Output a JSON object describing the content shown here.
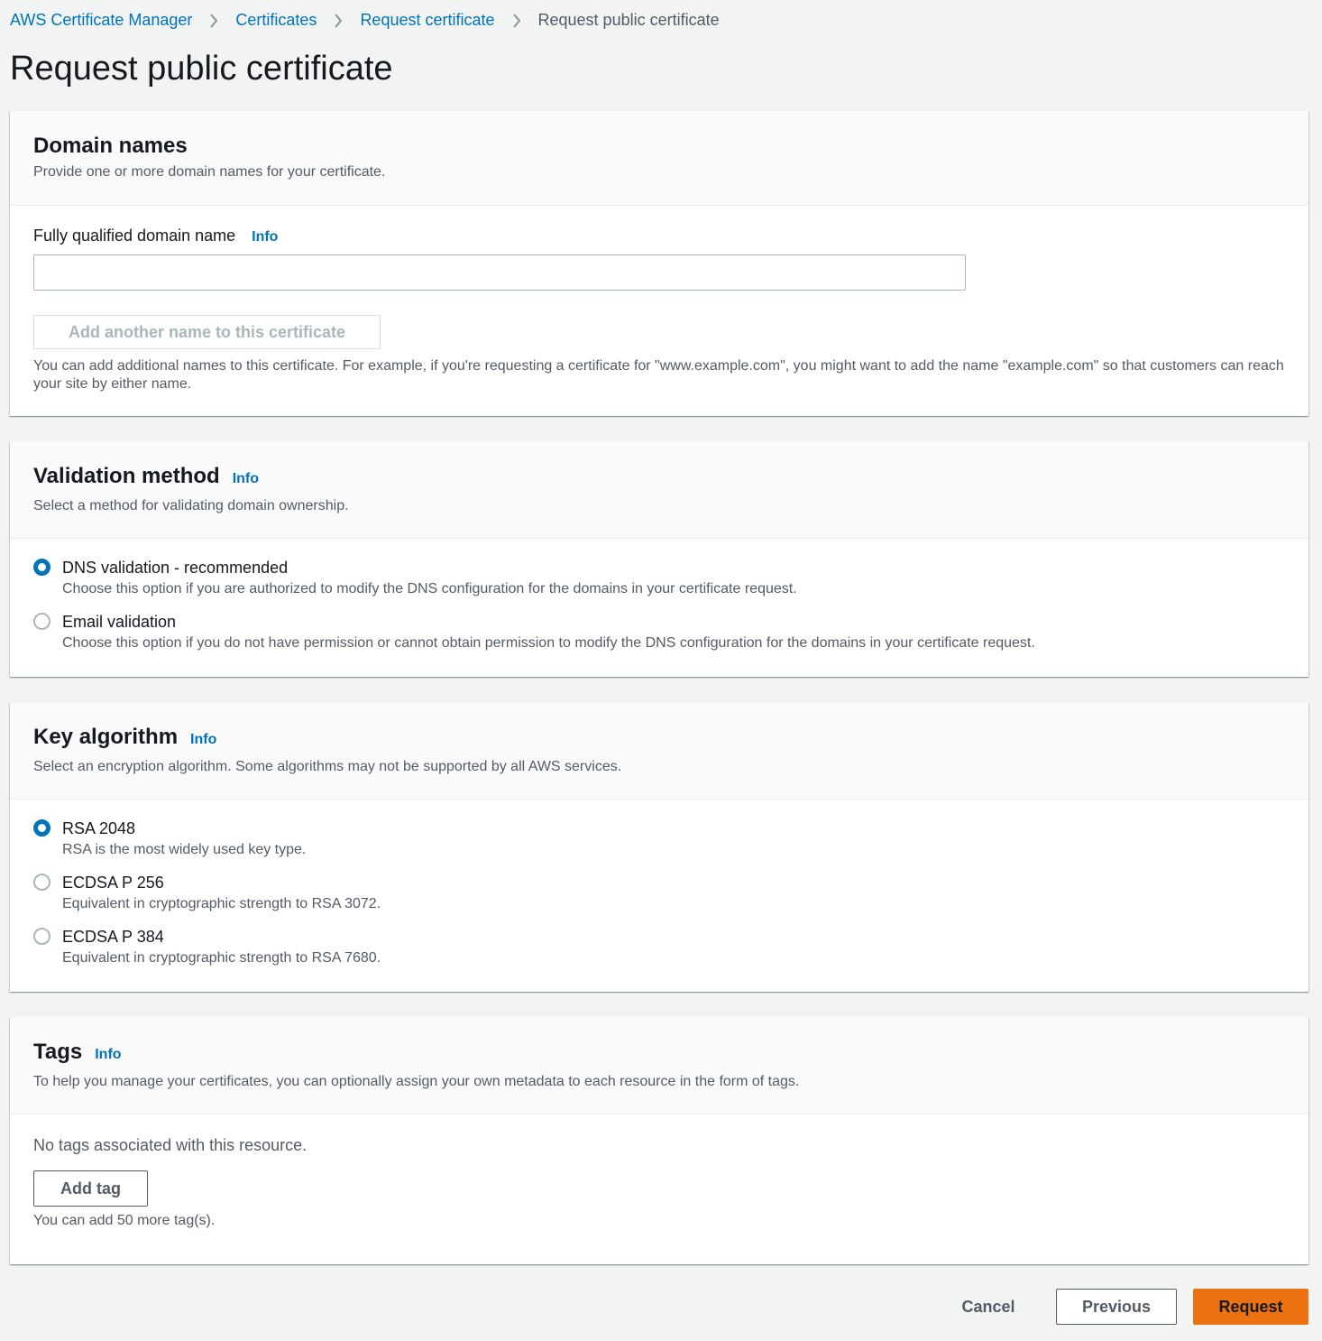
{
  "breadcrumb": {
    "items": [
      "AWS Certificate Manager",
      "Certificates",
      "Request certificate"
    ],
    "current": "Request public certificate"
  },
  "page_title": "Request public certificate",
  "domain_names": {
    "title": "Domain names",
    "description": "Provide one or more domain names for your certificate.",
    "field_label": "Fully qualified domain name",
    "info": "Info",
    "input_value": "",
    "add_button": "Add another name to this certificate",
    "help": "You can add additional names to this certificate. For example, if you're requesting a certificate for \"www.example.com\", you might want to add the name \"example.com\" so that customers can reach your site by either name."
  },
  "validation": {
    "title": "Validation method",
    "info": "Info",
    "description": "Select a method for validating domain ownership.",
    "options": [
      {
        "label": "DNS validation - recommended",
        "desc": "Choose this option if you are authorized to modify the DNS configuration for the domains in your certificate request.",
        "checked": true
      },
      {
        "label": "Email validation",
        "desc": "Choose this option if you do not have permission or cannot obtain permission to modify the DNS configuration for the domains in your certificate request.",
        "checked": false
      }
    ]
  },
  "key_algorithm": {
    "title": "Key algorithm",
    "info": "Info",
    "description": "Select an encryption algorithm. Some algorithms may not be supported by all AWS services.",
    "options": [
      {
        "label": "RSA 2048",
        "desc": "RSA is the most widely used key type.",
        "checked": true
      },
      {
        "label": "ECDSA P 256",
        "desc": "Equivalent in cryptographic strength to RSA 3072.",
        "checked": false
      },
      {
        "label": "ECDSA P 384",
        "desc": "Equivalent in cryptographic strength to RSA 7680.",
        "checked": false
      }
    ]
  },
  "tags": {
    "title": "Tags",
    "info": "Info",
    "description": "To help you manage your certificates, you can optionally assign your own metadata to each resource in the form of tags.",
    "empty_text": "No tags associated with this resource.",
    "add_button": "Add tag",
    "limit_text": "You can add 50 more tag(s)."
  },
  "footer": {
    "cancel": "Cancel",
    "previous": "Previous",
    "request": "Request"
  },
  "colors": {
    "link": "#0073bb",
    "primary": "#ec7211",
    "background": "#f2f3f3"
  }
}
